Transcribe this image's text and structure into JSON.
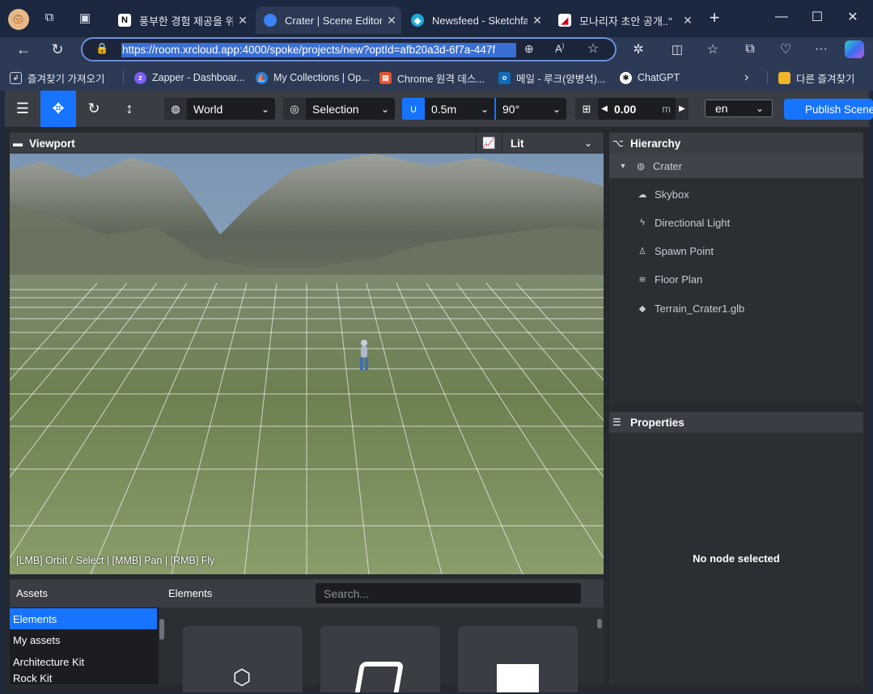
{
  "browser": {
    "tabs": [
      {
        "title": "풍부한 경험 제공을 위",
        "favicon": "N"
      },
      {
        "title": "Crater | Scene Editor",
        "favicon": ""
      },
      {
        "title": "Newsfeed - Sketchfab",
        "favicon": ""
      },
      {
        "title": "모나리자 초안 공개..\"",
        "favicon": ""
      }
    ],
    "url": "https://room.xrcloud.app:4000/spoke/projects/new?optId=afb20a3d-6f7a-447f",
    "bookmarks": [
      {
        "label": "즐겨찾기 가져오기",
        "icon": "import-icon"
      },
      {
        "label": "Zapper - Dashboar...",
        "icon": "zapper-icon"
      },
      {
        "label": "My Collections | Op...",
        "icon": "opensea-icon"
      },
      {
        "label": "Chrome 원격 데스...",
        "icon": "remote-desktop-icon"
      },
      {
        "label": "메일 - 루크(양병석)...",
        "icon": "outlook-icon"
      },
      {
        "label": "ChatGPT",
        "icon": "chatgpt-icon"
      }
    ],
    "other_favorites": "다른 즐겨찾기"
  },
  "toolbar": {
    "transform_space": "World",
    "pivot": "Selection",
    "snap_translate": "0.5m",
    "snap_rotate": "90°",
    "grid_height": "0.00",
    "grid_unit": "m",
    "language": "en",
    "publish_label": "Publish Scene"
  },
  "viewport": {
    "title": "Viewport",
    "render_mode": "Lit",
    "controls_hint": "[LMB] Orbit / Select | [MMB] Pan | [RMB] Fly"
  },
  "hierarchy": {
    "title": "Hierarchy",
    "root": "Crater",
    "items": [
      {
        "label": "Skybox",
        "icon": "cloud-icon"
      },
      {
        "label": "Directional Light",
        "icon": "bolt-icon"
      },
      {
        "label": "Spawn Point",
        "icon": "spawn-point-icon"
      },
      {
        "label": "Floor Plan",
        "icon": "floor-plan-icon"
      },
      {
        "label": "Terrain_Crater1.glb",
        "icon": "cube-icon"
      }
    ]
  },
  "properties": {
    "title": "Properties",
    "empty_message": "No node selected"
  },
  "assets": {
    "title": "Assets",
    "sources": [
      "Elements",
      "My assets",
      "Architecture Kit",
      "Rock Kit"
    ],
    "selected_index": 0,
    "panel_title": "Elements",
    "search_placeholder": "Search..."
  },
  "colors": {
    "accent": "#1774ff",
    "panel_bg": "#2b2e33",
    "toolbar_bg": "#3a3d44"
  }
}
